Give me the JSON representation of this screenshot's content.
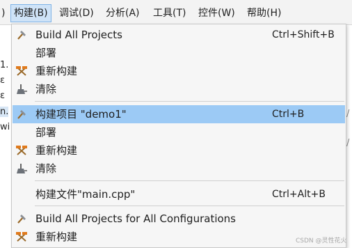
{
  "menubar": {
    "items": [
      {
        "label": ")"
      },
      {
        "label": "构建(B)"
      },
      {
        "label": "调试(D)"
      },
      {
        "label": "分析(A)"
      },
      {
        "label": "工具(T)"
      },
      {
        "label": "控件(W)"
      },
      {
        "label": "帮助(H)"
      }
    ]
  },
  "background_fragments": [
    {
      "text": "1."
    },
    {
      "text": "ɛ"
    },
    {
      "text": "ɛ"
    },
    {
      "text": "n."
    },
    {
      "text": "wi"
    }
  ],
  "right_fragments": [
    {
      "text": "/"
    },
    {
      "text": "/"
    }
  ],
  "dropdown": {
    "items": [
      {
        "icon": "hammer-icon",
        "label": "Build All Projects",
        "shortcut": "Ctrl+Shift+B"
      },
      {
        "icon": "",
        "label": "部署",
        "shortcut": ""
      },
      {
        "icon": "rebuild-hammers-icon",
        "label": "重新构建",
        "shortcut": ""
      },
      {
        "icon": "broom-icon",
        "label": "清除",
        "shortcut": ""
      },
      {
        "icon": "hammer-icon",
        "label": "构建项目 \"demo1\"",
        "shortcut": "Ctrl+B"
      },
      {
        "icon": "",
        "label": "部署",
        "shortcut": ""
      },
      {
        "icon": "rebuild-hammers-icon",
        "label": "重新构建",
        "shortcut": ""
      },
      {
        "icon": "broom-icon",
        "label": "清除",
        "shortcut": ""
      },
      {
        "icon": "",
        "label": "构建文件\"main.cpp\"",
        "shortcut": "Ctrl+Alt+B"
      },
      {
        "icon": "hammer-icon",
        "label": "Build All Projects for All Configurations",
        "shortcut": ""
      },
      {
        "icon": "rebuild-hammers-icon",
        "label": "重新构建",
        "shortcut": ""
      }
    ]
  },
  "watermark": "CSDN @灵性花火"
}
